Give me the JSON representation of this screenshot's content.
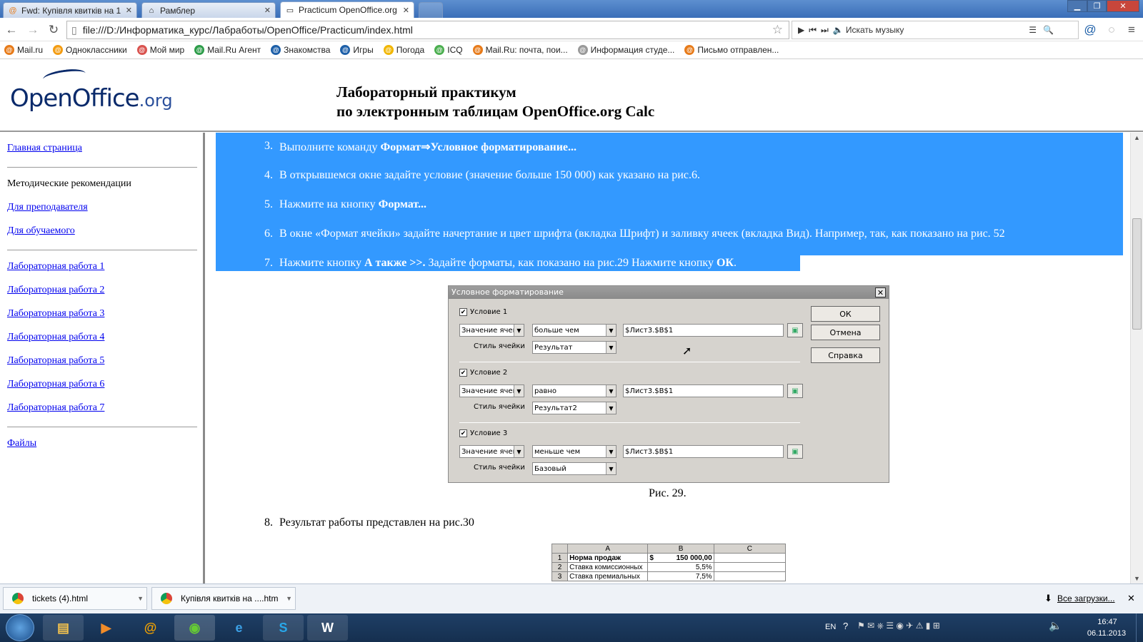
{
  "browser": {
    "tabs": [
      {
        "title": "Fwd: Купівля квитків на 1",
        "icon": "mail-ru-icon"
      },
      {
        "title": "Рамблер",
        "icon": "home-icon"
      },
      {
        "title": "Practicum OpenOffice.org",
        "icon": "page-icon"
      }
    ],
    "url": "file:///D:/Информатика_курс/Лабработы/OpenOffice/Practicum/index.html",
    "music_search_placeholder": "Искать музыку",
    "bookmarks": [
      {
        "label": "Mail.ru",
        "color": "#e77b1a"
      },
      {
        "label": "Одноклассники",
        "color": "#f39c12"
      },
      {
        "label": "Мой мир",
        "color": "#d9534f"
      },
      {
        "label": "Mail.Ru Агент",
        "color": "#2e9d4a"
      },
      {
        "label": "Знакомства",
        "color": "#1d5fa8"
      },
      {
        "label": "Игры",
        "color": "#1d5fa8"
      },
      {
        "label": "Погода",
        "color": "#f1b600"
      },
      {
        "label": "ICQ",
        "color": "#4caf50"
      },
      {
        "label": "Mail.Ru: почта, пои...",
        "color": "#e77b1a"
      },
      {
        "label": "Информация студе...",
        "color": "#999999"
      },
      {
        "label": "Письмо отправлен...",
        "color": "#e77b1a"
      }
    ]
  },
  "page": {
    "logo_main": "OpenOffice",
    "logo_suffix": ".org",
    "title_line1": "Лабораторный практикум",
    "title_line2": "по электронным таблицам OpenOffice.org Calc",
    "sidebar": {
      "home": "Главная страница",
      "method_heading": "Методические рекомендации",
      "teacher": "Для преподавателя",
      "student": "Для обучаемого",
      "labs": [
        "Лабораторная работа 1",
        "Лабораторная работа 2",
        "Лабораторная работа 3",
        "Лабораторная работа 4",
        "Лабораторная работа 5",
        "Лабораторная работа 6",
        "Лабораторная работа 7"
      ],
      "files": "Файлы"
    },
    "steps": [
      {
        "num": "3.",
        "pre": "Выполните команду ",
        "bold": "Формат⇒Условное форматирование...",
        "post": ""
      },
      {
        "num": "4.",
        "pre": "В открывшемся окне задайте условие (значение больше 150 000) как указано на рис.6.",
        "bold": "",
        "post": ""
      },
      {
        "num": "5.",
        "pre": "Нажмите на кнопку ",
        "bold": "Формат...",
        "post": ""
      },
      {
        "num": "6.",
        "pre": "В окне «Формат ячейки» задайте начертание и цвет шрифта (вкладка Шрифт) и заливку ячеек (вкладка Вид). Например, так, как показано на рис. 52",
        "bold": "",
        "post": ""
      }
    ],
    "step7": {
      "num": "7.",
      "a": "Нажмите кнопку ",
      "b": "А также >>.",
      "c": " Задайте форматы, как показано на рис.29 Нажмите кнопку ",
      "d": "ОК",
      "e": "."
    },
    "fig29_caption": "Рис. 29.",
    "step8": {
      "num": "8.",
      "text": "Результат работы представлен на рис.30"
    },
    "dialog": {
      "title": "Условное форматирование",
      "style_label": "Стиль ячейки",
      "conditions": [
        {
          "label": "Условие 1",
          "type": "Значение ячей",
          "op": "больше чем",
          "value": "$Лист3.$B$1",
          "style": "Результат"
        },
        {
          "label": "Условие 2",
          "type": "Значение ячей",
          "op": "равно",
          "value": "$Лист3.$B$1",
          "style": "Результат2"
        },
        {
          "label": "Условие 3",
          "type": "Значение ячей",
          "op": "меньше чем",
          "value": "$Лист3.$B$1",
          "style": "Базовый"
        }
      ],
      "ok": "ОК",
      "cancel": "Отмена",
      "help": "Справка"
    },
    "sheet": {
      "cols": [
        "",
        "A",
        "B",
        "C"
      ],
      "rows": [
        [
          "1",
          "Норма продаж",
          "$",
          "150 000,00"
        ],
        [
          "2",
          "Ставка комиссионных",
          "",
          "5,5%"
        ],
        [
          "3",
          "Ставка премиальных",
          "",
          "7,5%"
        ]
      ]
    }
  },
  "downloads": {
    "items": [
      "tickets (4).html",
      "Купівля квитків на ....htm"
    ],
    "all_label": "Все загрузки..."
  },
  "taskbar": {
    "lang": "EN",
    "time": "16:47",
    "date": "06.11.2013"
  }
}
